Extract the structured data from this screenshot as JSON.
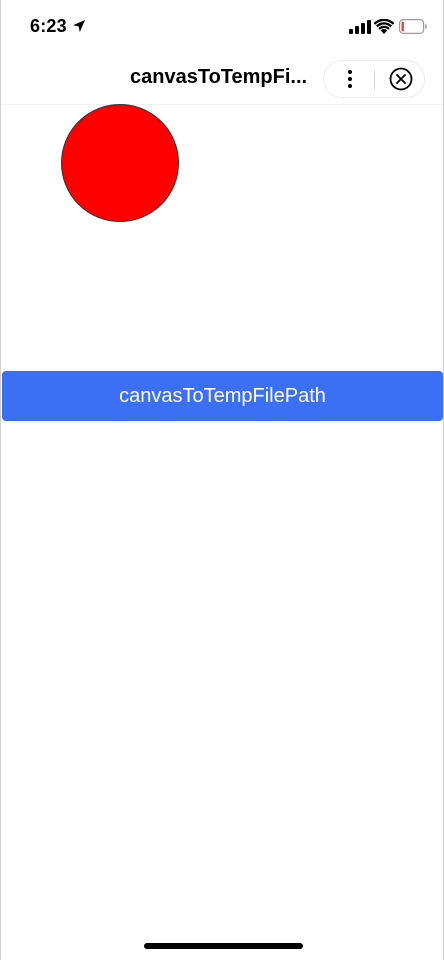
{
  "status_bar": {
    "time": "6:23",
    "icons": [
      "location-arrow-icon",
      "cellular-signal-icon",
      "wifi-icon",
      "battery-icon"
    ]
  },
  "nav_bar": {
    "title": "canvasToTempFi...",
    "icons": [
      "more-dots-icon",
      "close-circle-icon"
    ]
  },
  "canvas": {
    "shape": "circle",
    "fill_color": "#ff0000",
    "stroke_color": "#333333"
  },
  "action_button": {
    "label": "canvasToTempFilePath",
    "color": "#3b70f5",
    "text_color": "#ffffff"
  },
  "battery": {
    "level_percent": 8,
    "color": "#ff3b30"
  }
}
